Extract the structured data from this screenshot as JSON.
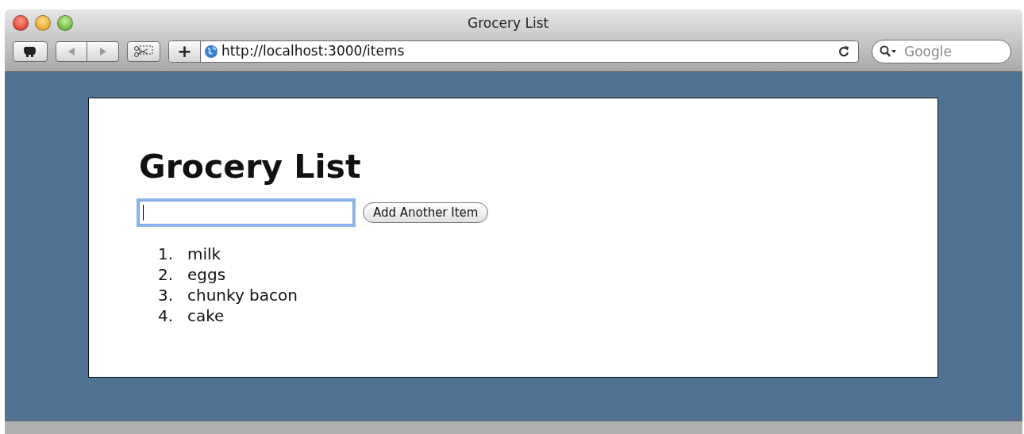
{
  "window": {
    "title": "Grocery List"
  },
  "toolbar": {
    "address": "http://localhost:3000/items",
    "search": {
      "placeholder": "Google"
    },
    "add_button": "+"
  },
  "page": {
    "heading": "Grocery List",
    "field": {
      "focused": true
    },
    "submit": "Add Another Item",
    "items": [
      {
        "number": "1.",
        "text": "milk"
      },
      {
        "number": "2.",
        "text": "eggs"
      },
      {
        "number": "3.",
        "text": "chunky bacon"
      },
      {
        "number": "4.",
        "text": "cake"
      }
    ]
  }
}
